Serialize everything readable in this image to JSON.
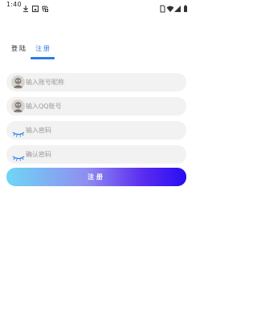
{
  "status_bar": {
    "time": "1:40",
    "left_icons": [
      "download-icon",
      "image-notification-icon",
      "app-notification-icon"
    ],
    "right_icons": [
      "sim-card-icon",
      "wifi-icon",
      "signal-icon",
      "battery-icon"
    ]
  },
  "tabs": [
    {
      "label": "登陆",
      "active": false
    },
    {
      "label": "注册",
      "active": true
    }
  ],
  "fields": [
    {
      "placeholder": "输入账号昵称",
      "icon": "avatar-icon"
    },
    {
      "placeholder": "输入QQ账号",
      "icon": "avatar-icon"
    },
    {
      "placeholder": "输入密码",
      "icon": "closed-eye-icon"
    },
    {
      "placeholder": "确认密码",
      "icon": "closed-eye-icon"
    }
  ],
  "submit": {
    "label": "注册"
  },
  "colors": {
    "accent": "#2b7ee8",
    "field_bg": "#f2f2f2",
    "button_gradient_start": "#6fd6f5",
    "button_gradient_end": "#2a0df5"
  }
}
